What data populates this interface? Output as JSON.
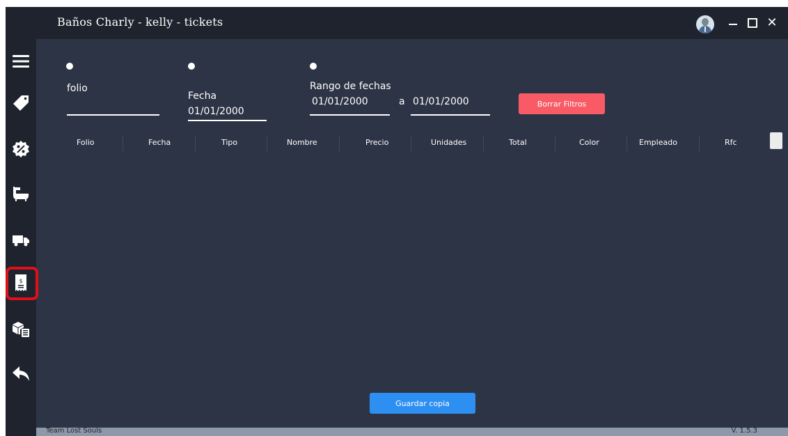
{
  "window": {
    "title": "Baños Charly - kelly - tickets",
    "controls": {
      "minimize_glyph": "—",
      "maximize_glyph": "□",
      "close_glyph": "✕"
    }
  },
  "sidebar": {
    "items": [
      {
        "name": "menu",
        "icon": "hamburger-menu-icon"
      },
      {
        "name": "sales",
        "icon": "sale-tag-icon"
      },
      {
        "name": "discounts",
        "icon": "percent-badge-icon"
      },
      {
        "name": "products",
        "icon": "bathtub-icon"
      },
      {
        "name": "deliveries",
        "icon": "truck-icon"
      },
      {
        "name": "tickets",
        "icon": "receipt-icon",
        "selected": true
      },
      {
        "name": "inventory",
        "icon": "boxes-icon"
      },
      {
        "name": "back",
        "icon": "reply-arrow-icon"
      }
    ],
    "highlight_color": "#e0101b"
  },
  "filters": {
    "folio": {
      "label": "folio",
      "value": ""
    },
    "fecha": {
      "label": "Fecha",
      "value": "01/01/2000"
    },
    "rango": {
      "label": "Rango de fechas",
      "from": "01/01/2000",
      "separator": "a",
      "to": "01/01/2000"
    },
    "clear_button": "Borrar Filtros"
  },
  "table": {
    "columns": [
      "Folio",
      "Fecha",
      "Tipo",
      "Nombre",
      "Precio",
      "Unidades",
      "Total",
      "Color",
      "Empleado",
      "Rfc"
    ],
    "rows": []
  },
  "save_button": "Guardar copia",
  "status": {
    "left": "Team Lost Souls",
    "right": "V. 1.5.3"
  },
  "colors": {
    "background": "#2d3445",
    "sidebar": "#1f232d",
    "clear_button": "#f85b66",
    "save_button": "#2d8ff2",
    "status_bar": "#8d99a8"
  }
}
